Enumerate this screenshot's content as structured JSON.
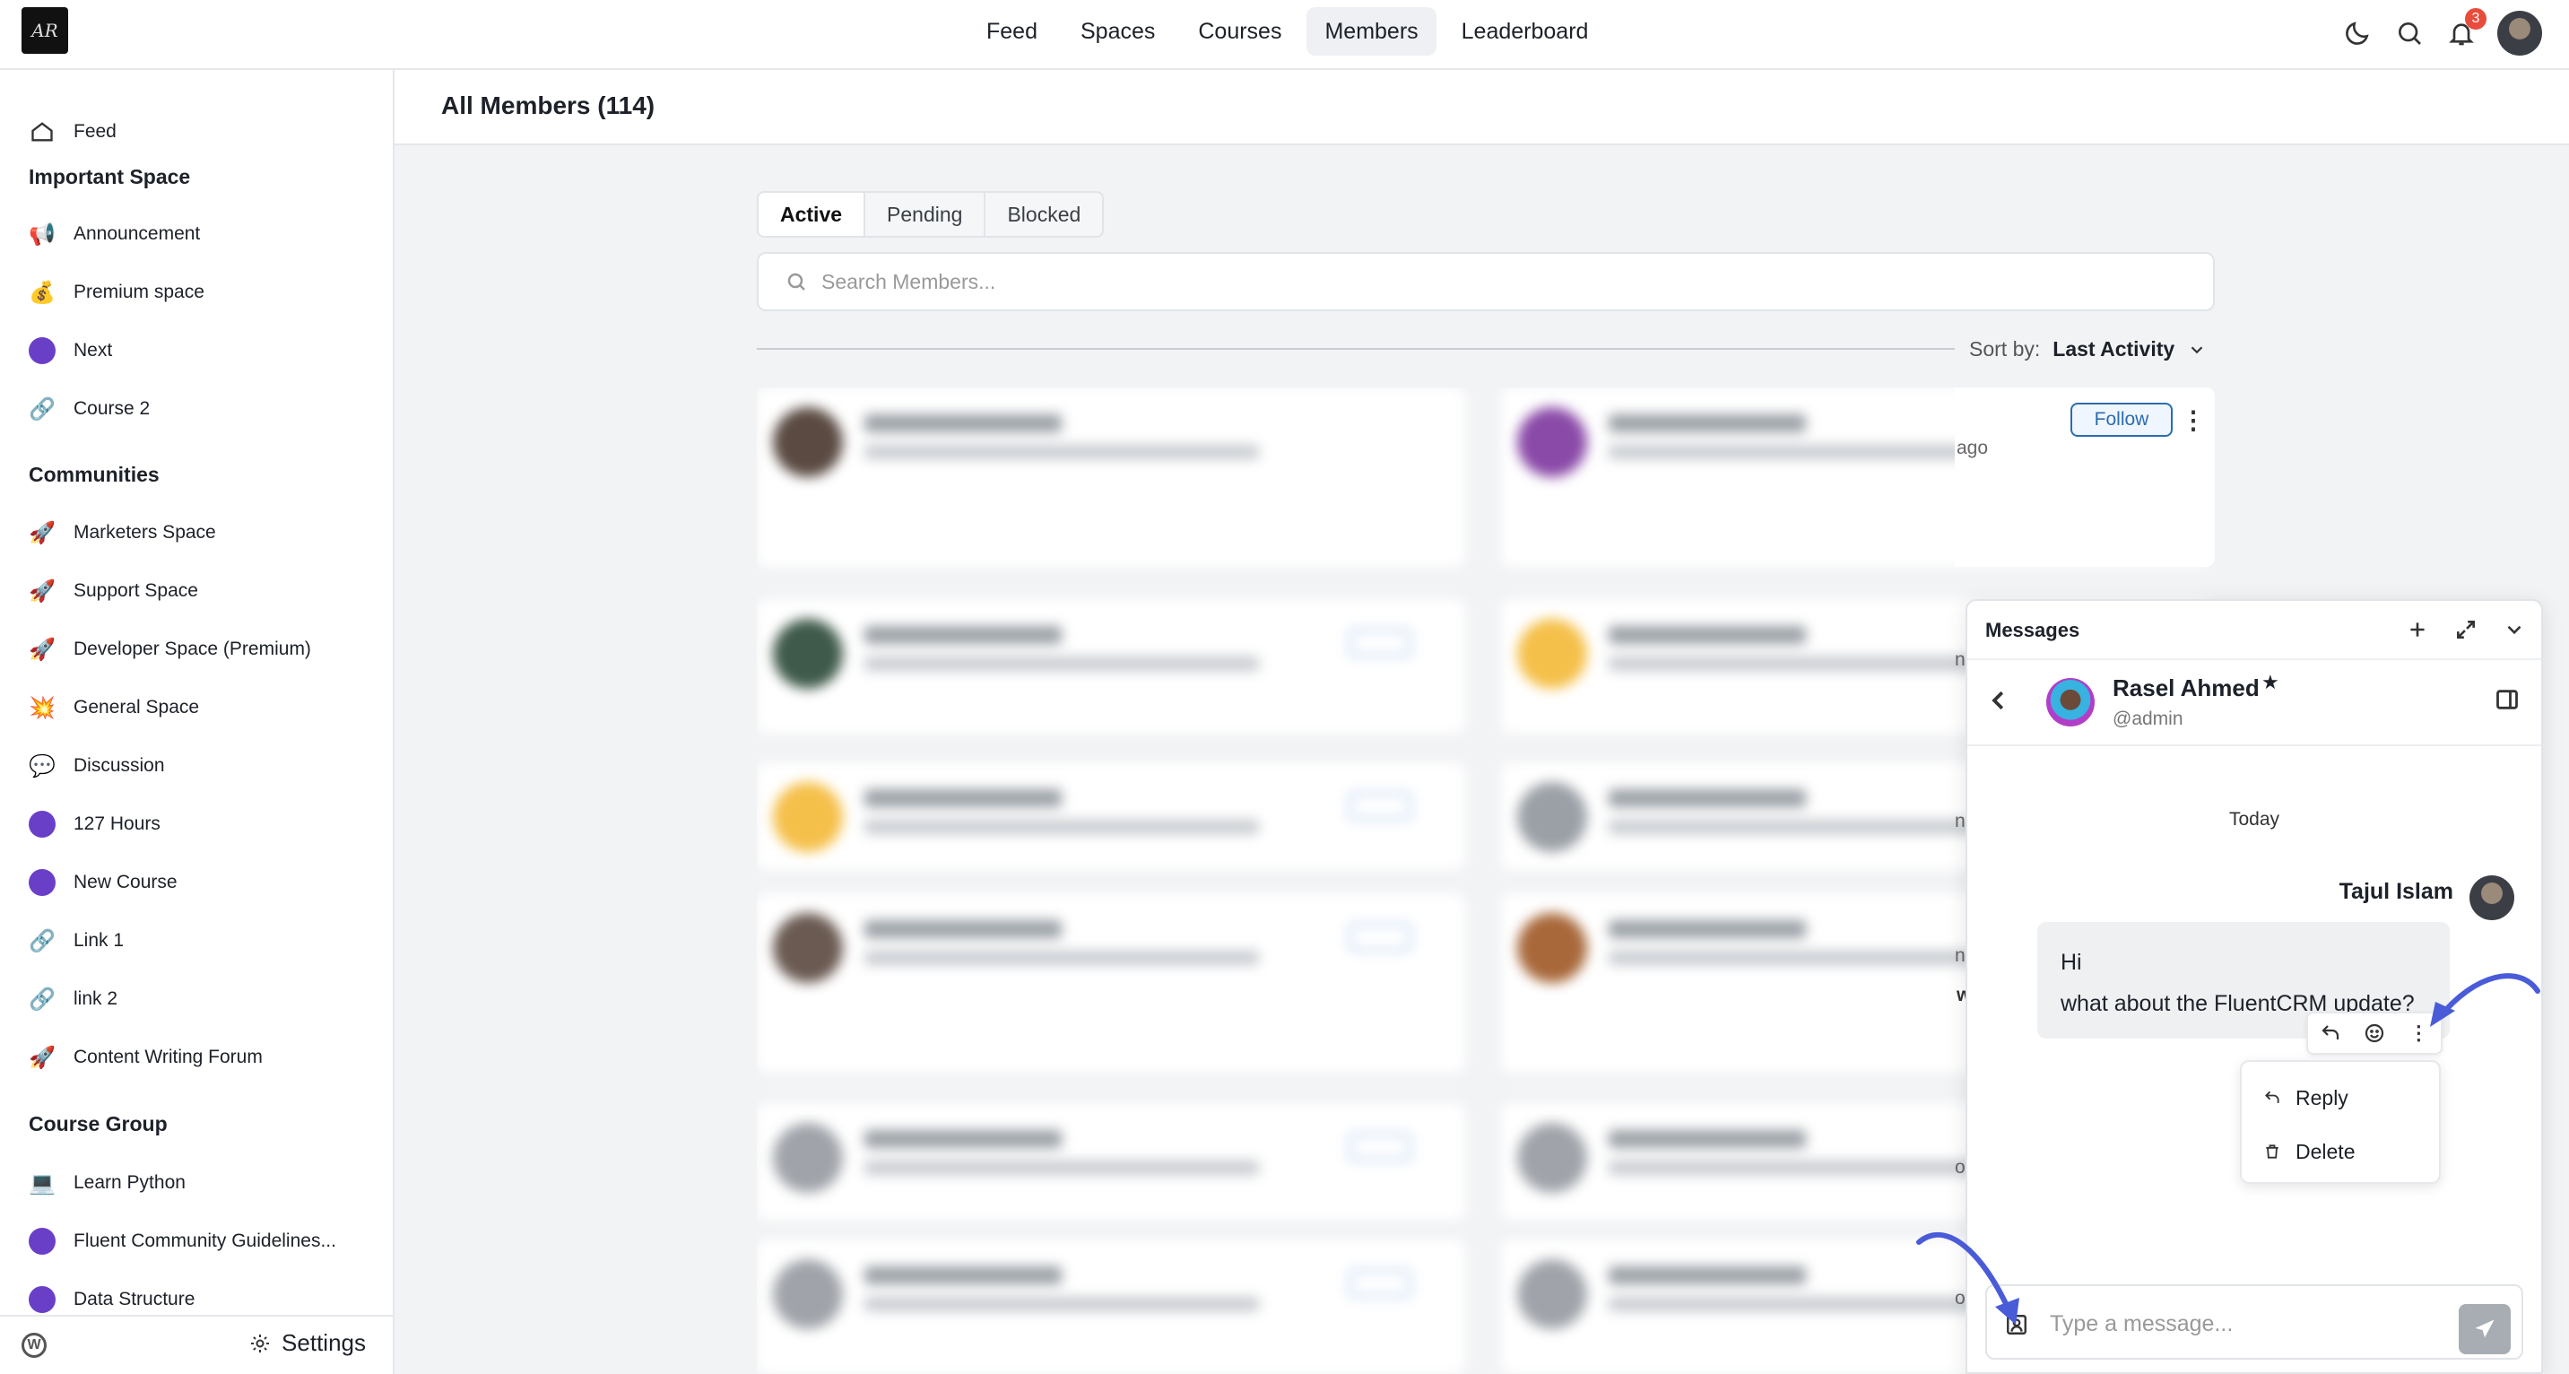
{
  "top": {
    "logo_text": "AR",
    "nav": [
      {
        "label": "Feed",
        "active": false
      },
      {
        "label": "Spaces",
        "active": false
      },
      {
        "label": "Courses",
        "active": false
      },
      {
        "label": "Members",
        "active": true
      },
      {
        "label": "Leaderboard",
        "active": false
      }
    ],
    "notification_count": "3"
  },
  "sidebar": {
    "feed": {
      "label": "Feed",
      "icon": "home-icon"
    },
    "groups": [
      {
        "heading": "Important Space",
        "items": [
          {
            "label": "Announcement",
            "icon": "megaphone-icon"
          },
          {
            "label": "Premium space",
            "icon": "money-bag-icon"
          },
          {
            "label": "Next",
            "icon": "purple-dot-icon"
          },
          {
            "label": "Course 2",
            "icon": "link-icon"
          }
        ]
      },
      {
        "heading": "Communities",
        "items": [
          {
            "label": "Marketers Space",
            "icon": "rocket-icon"
          },
          {
            "label": "Support Space",
            "icon": "rocket-icon"
          },
          {
            "label": "Developer Space (Premium)",
            "icon": "rocket-icon"
          },
          {
            "label": "General Space",
            "icon": "burst-icon"
          },
          {
            "label": "Discussion",
            "icon": "speech-bubble-icon"
          },
          {
            "label": "127 Hours",
            "icon": "purple-dot-icon"
          },
          {
            "label": "New Course",
            "icon": "purple-dot-icon"
          },
          {
            "label": "Link 1",
            "icon": "link-icon"
          },
          {
            "label": "link 2",
            "icon": "link-icon"
          },
          {
            "label": "Content Writing Forum",
            "icon": "rocket-icon"
          }
        ]
      },
      {
        "heading": "Course Group",
        "items": [
          {
            "label": "Learn Python",
            "icon": "laptop-icon"
          },
          {
            "label": "Fluent Community Guidelines...",
            "icon": "purple-dot-icon"
          },
          {
            "label": "Data Structure",
            "icon": "purple-dot-icon"
          }
        ]
      }
    ],
    "settings_label": "Settings"
  },
  "main": {
    "title": "All Members (114)",
    "tabs": [
      {
        "label": "Active",
        "active": true
      },
      {
        "label": "Pending",
        "active": false
      },
      {
        "label": "Blocked",
        "active": false
      }
    ],
    "search_placeholder": "Search Members...",
    "sort_label": "Sort by:",
    "sort_value": "Last Activity",
    "follow_label": "Follow",
    "ago_text": "ago",
    "edge_fragments": [
      "nt",
      "nth",
      "nth",
      "w",
      "o",
      "o"
    ]
  },
  "messages": {
    "title": "Messages",
    "contact_name": "Rasel Ahmed",
    "contact_handle": "@admin",
    "day_label": "Today",
    "sender": "Tajul Islam",
    "message_lines": [
      "Hi",
      "what about the FluentCRM update?"
    ],
    "menu": [
      {
        "label": "Reply",
        "icon": "reply-icon"
      },
      {
        "label": "Delete",
        "icon": "trash-icon"
      }
    ],
    "composer_placeholder": "Type a message..."
  },
  "colors": {
    "accent_blue": "#2b6cb0",
    "arrow_blue": "#4a5bd8",
    "space_dot": "#6a3fc8"
  }
}
